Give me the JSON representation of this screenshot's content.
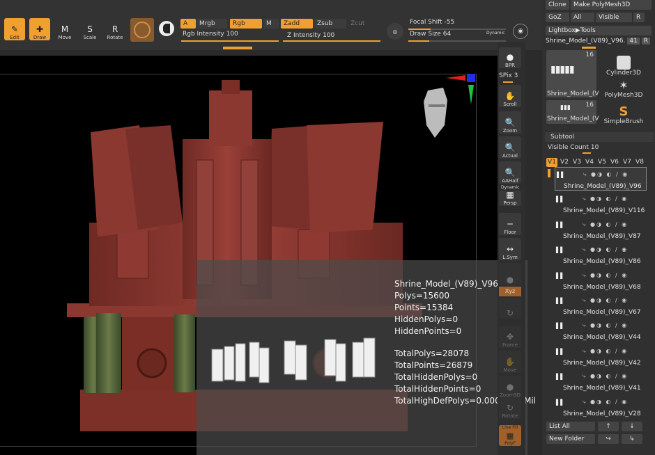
{
  "colors": {
    "accent": "#f0a030",
    "panel": "#303030",
    "viewport": "#000000",
    "model": "#8a3a32"
  },
  "toolbar": {
    "edit": "Edit",
    "draw": "Draw",
    "move": "Move",
    "scale": "Scale",
    "rotate": "Rotate",
    "a": "A",
    "mrgb": "Mrgb",
    "rgb": "Rgb",
    "m": "M",
    "zadd": "Zadd",
    "zsub": "Zsub",
    "zcut": "Zcut",
    "rgb_intensity_label": "Rgb Intensity",
    "rgb_intensity_value": "100",
    "z_intensity_label": "Z Intensity",
    "z_intensity_value": "100",
    "focal_shift_label": "Focal Shift",
    "focal_shift_value": "-55",
    "draw_size_label": "Draw Size",
    "draw_size_value": "64",
    "dynamic": "Dynamic"
  },
  "right_bar": {
    "bpr": "BPR",
    "spix_label": "SPix",
    "spix_value": "3",
    "scroll": "Scroll",
    "zoom": "Zoom",
    "actual": "Actual",
    "aahalf": "AAHalf",
    "dynamic": "Dynamic",
    "persp": "Persp",
    "floor": "Floor",
    "lsym": "L.Sym",
    "xyz": "Xyz",
    "frame": "Frame",
    "move": "Move",
    "zoom3d": "Zoom3D",
    "rotate": "Rotate",
    "line_fill": "Line Fill",
    "polyf": "PolyF"
  },
  "tool_panel": {
    "clone": "Clone",
    "make_polymesh": "Make PolyMesh3D",
    "goz": "GoZ",
    "all": "All",
    "visible": "Visible",
    "r": "R",
    "lightbox_tools": "Lightbox▶Tools",
    "current_tool": "Shrine_Model_(V89)_V96.",
    "current_count": "41",
    "thumb1_count": "16",
    "thumb1_label": "Shrine_Model_(V",
    "thumb2_count": "16",
    "thumb2_label": "Shrine_Model_(V",
    "cylinder": "Cylinder3D",
    "polymesh": "PolyMesh3D",
    "simplebrush": "SimpleBrush"
  },
  "subtool": {
    "header": "Subtool",
    "visible_count_label": "Visible Count",
    "visible_count_value": "10",
    "tabs": [
      "V1",
      "V2",
      "V3",
      "V4",
      "V5",
      "V6",
      "V7",
      "V8"
    ],
    "items": [
      {
        "name": "Shrine_Model_(V89)_V96"
      },
      {
        "name": "Shrine_Model_(V89)_V116"
      },
      {
        "name": "Shrine_Model_(V89)_V87"
      },
      {
        "name": "Shrine_Model_(V89)_V86"
      },
      {
        "name": "Shrine_Model_(V89)_V68"
      },
      {
        "name": "Shrine_Model_(V89)_V67"
      },
      {
        "name": "Shrine_Model_(V89)_V44"
      },
      {
        "name": "Shrine_Model_(V89)_V42"
      },
      {
        "name": "Shrine_Model_(V89)_V41"
      },
      {
        "name": "Shrine_Model_(V89)_V28"
      }
    ],
    "list_all": "List All",
    "new_folder": "New Folder"
  },
  "info": {
    "tool_name": "Shrine_Model_(V89)_V96",
    "polys": "Polys=15600",
    "points": "Points=15384",
    "hidden_polys": "HiddenPolys=0",
    "hidden_points": "HiddenPoints=0",
    "total_polys": "TotalPolys=28078",
    "total_points": "TotalPoints=26879",
    "total_hidden_polys": "TotalHiddenPolys=0",
    "total_hidden_points": "TotalHiddenPoints=0",
    "total_highdef": "TotalHighDefPolys=0.0000000 Mil"
  }
}
